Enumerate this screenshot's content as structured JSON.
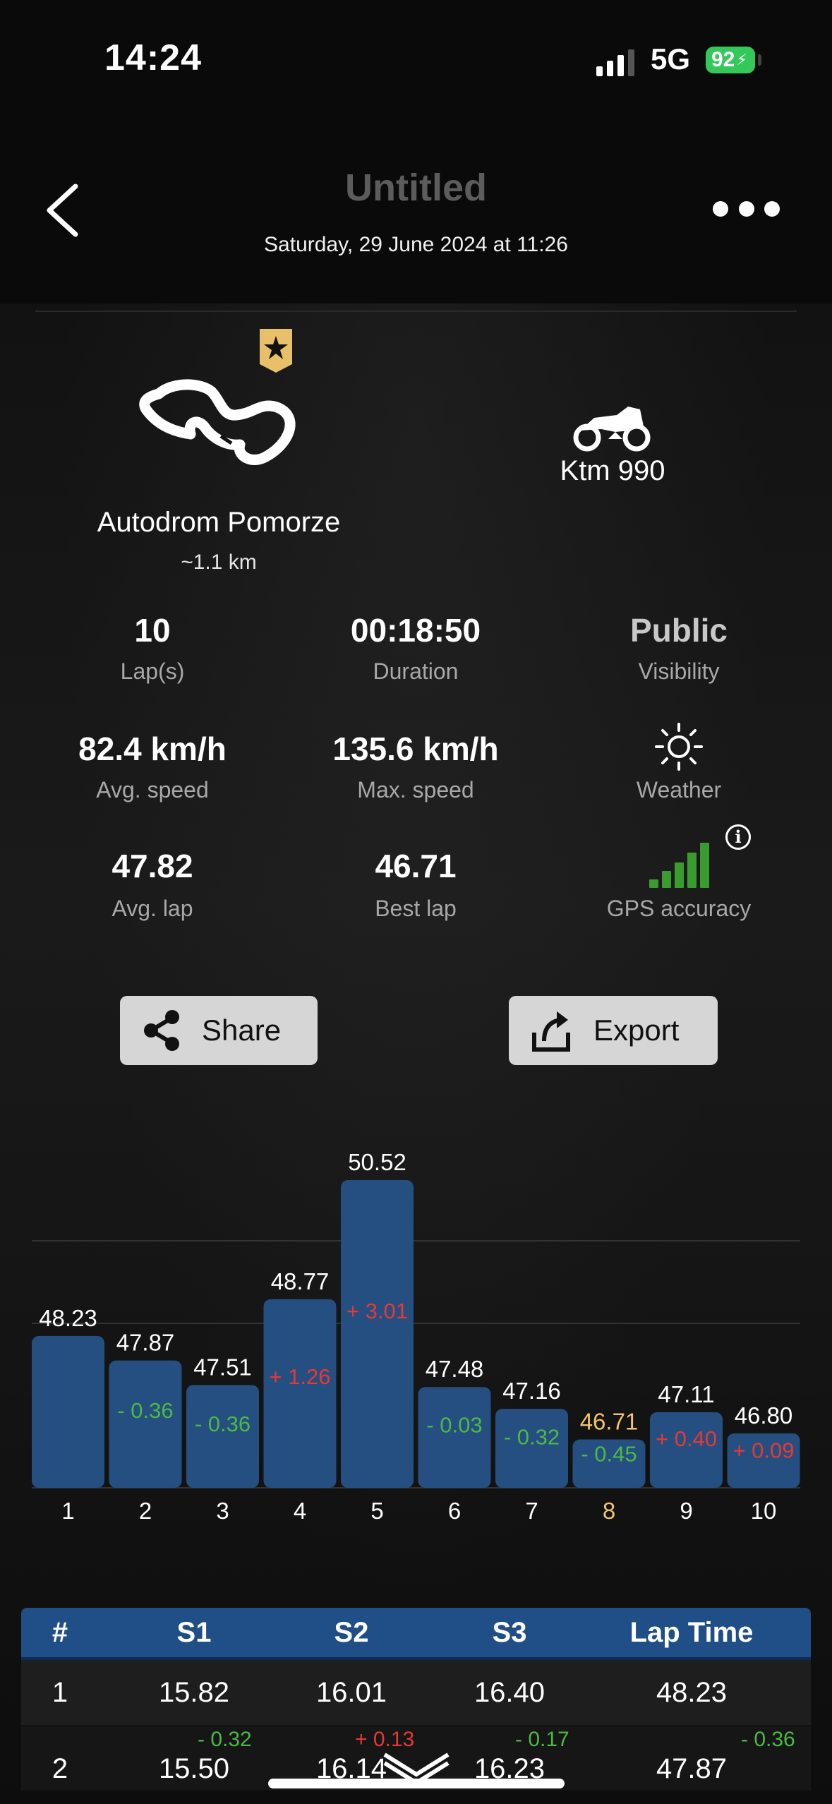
{
  "status": {
    "time": "14:24",
    "network": "5G",
    "battery": "92"
  },
  "header": {
    "title": "Untitled",
    "date": "Saturday, 29 June 2024 at 11:26"
  },
  "track": {
    "name": "Autodrom Pomorze",
    "length": "~1.1 km"
  },
  "bike": {
    "name": "Ktm 990"
  },
  "stats": {
    "laps": {
      "value": "10",
      "label": "Lap(s)"
    },
    "duration": {
      "value": "00:18:50",
      "label": "Duration"
    },
    "visibility": {
      "value": "Public",
      "label": "Visibility"
    },
    "avg_speed": {
      "value": "82.4 km/h",
      "label": "Avg. speed"
    },
    "max_speed": {
      "value": "135.6 km/h",
      "label": "Max. speed"
    },
    "weather": {
      "label": "Weather",
      "icon": "sun-icon"
    },
    "avg_lap": {
      "value": "47.82",
      "label": "Avg. lap"
    },
    "best_lap": {
      "value": "46.71",
      "label": "Best lap"
    },
    "gps": {
      "label": "GPS accuracy",
      "level": 5,
      "max": 5
    }
  },
  "buttons": {
    "share": "Share",
    "export": "Export"
  },
  "colors": {
    "bar": "#254f80",
    "green": "#4cb944",
    "red": "#e53935",
    "best": "#f2c36b",
    "table_header": "#1f4f86"
  },
  "chart_data": {
    "type": "bar",
    "categories": [
      "1",
      "2",
      "3",
      "4",
      "5",
      "6",
      "7",
      "8",
      "9",
      "10"
    ],
    "values": [
      48.23,
      47.87,
      47.51,
      48.77,
      50.52,
      47.48,
      47.16,
      46.71,
      47.11,
      46.8
    ],
    "value_labels": [
      "48.23",
      "47.87",
      "47.51",
      "48.77",
      "50.52",
      "47.48",
      "47.16",
      "46.71",
      "47.11",
      "46.80"
    ],
    "deltas": [
      "",
      "- 0.36",
      "- 0.36",
      "+ 1.26",
      "+ 3.01",
      "- 0.03",
      "- 0.32",
      "- 0.45",
      "+ 0.40",
      "+ 0.09"
    ],
    "delta_signs": [
      0,
      -1,
      -1,
      1,
      1,
      -1,
      -1,
      -1,
      1,
      1
    ],
    "best_index": 7,
    "ylim": [
      46.0,
      50.52
    ]
  },
  "table": {
    "headers": [
      "#",
      "S1",
      "S2",
      "S3",
      "Lap Time"
    ],
    "rows": [
      {
        "n": "1",
        "s1": "15.82",
        "s2": "16.01",
        "s3": "16.40",
        "lap": "48.23",
        "d1": "",
        "d2": "",
        "d3": "",
        "dl": ""
      },
      {
        "n": "2",
        "s1": "15.50",
        "s2": "16.14",
        "s3": "16.23",
        "lap": "47.87",
        "d1": "- 0.32",
        "d2": "+ 0.13",
        "d3": "- 0.17",
        "dl": "- 0.36"
      }
    ]
  }
}
